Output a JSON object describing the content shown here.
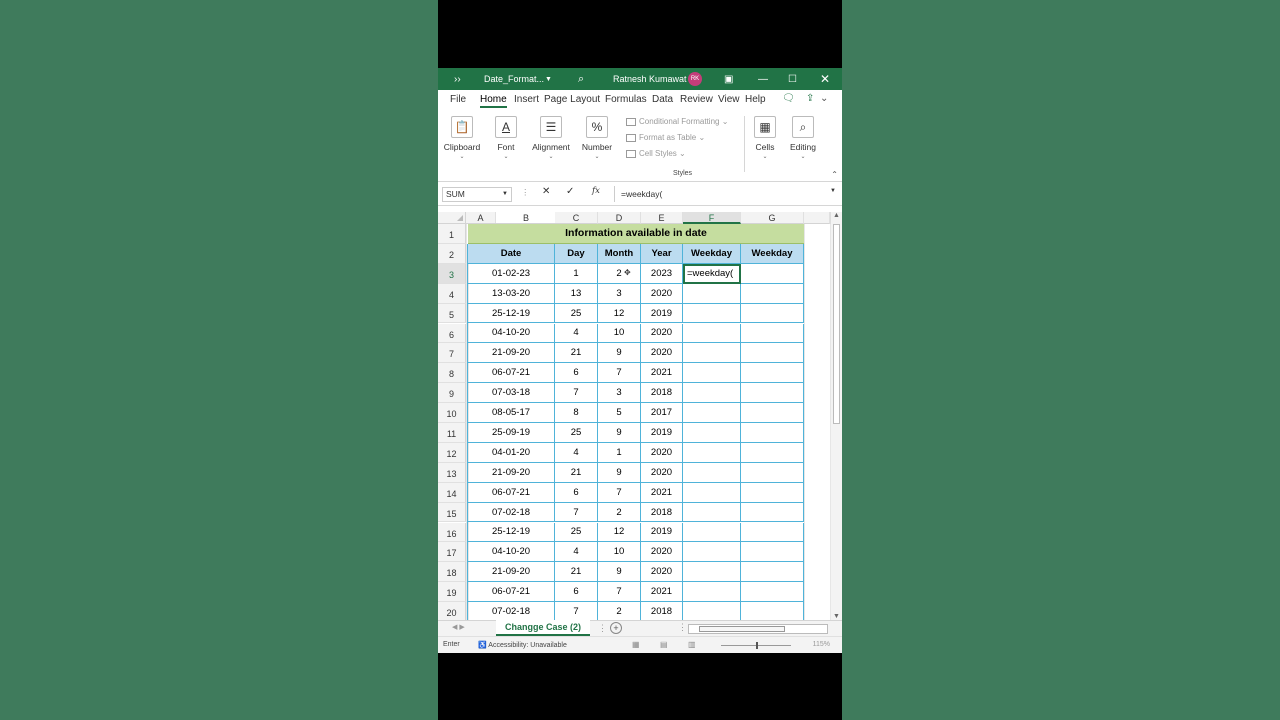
{
  "window": {
    "more": "››",
    "filename": "Date_Format...",
    "user": "Ratnesh Kumawat",
    "avatar_initials": "RK"
  },
  "menu_tabs": [
    "File",
    "Home",
    "Insert",
    "Page Layout",
    "Formulas",
    "Data",
    "Review",
    "View",
    "Help"
  ],
  "ribbon": {
    "clipboard": "Clipboard",
    "font": "Font",
    "alignment": "Alignment",
    "number": "Number",
    "conditional_formatting": "Conditional Formatting",
    "format_as_table": "Format as Table",
    "cell_styles": "Cell Styles",
    "styles": "Styles",
    "cells": "Cells",
    "editing": "Editing"
  },
  "formula_bar": {
    "name_box": "SUM",
    "formula": "=weekday("
  },
  "columns": [
    "A",
    "B",
    "C",
    "D",
    "E",
    "F",
    "G"
  ],
  "rows": [
    "1",
    "2",
    "3",
    "4",
    "5",
    "6",
    "7",
    "8",
    "9",
    "10",
    "11",
    "12",
    "13",
    "14",
    "15",
    "16",
    "17",
    "18",
    "19",
    "20"
  ],
  "table": {
    "title": "Information available in date",
    "headers": [
      "Date",
      "Day",
      "Month",
      "Year",
      "Weekday",
      "Weekday"
    ],
    "data": [
      [
        "01-02-23",
        "1",
        "2",
        "2023"
      ],
      [
        "13-03-20",
        "13",
        "3",
        "2020"
      ],
      [
        "25-12-19",
        "25",
        "12",
        "2019"
      ],
      [
        "04-10-20",
        "4",
        "10",
        "2020"
      ],
      [
        "21-09-20",
        "21",
        "9",
        "2020"
      ],
      [
        "06-07-21",
        "6",
        "7",
        "2021"
      ],
      [
        "07-03-18",
        "7",
        "3",
        "2018"
      ],
      [
        "08-05-17",
        "8",
        "5",
        "2017"
      ],
      [
        "25-09-19",
        "25",
        "9",
        "2019"
      ],
      [
        "04-01-20",
        "4",
        "1",
        "2020"
      ],
      [
        "21-09-20",
        "21",
        "9",
        "2020"
      ],
      [
        "06-07-21",
        "6",
        "7",
        "2021"
      ],
      [
        "07-02-18",
        "7",
        "2",
        "2018"
      ],
      [
        "25-12-19",
        "25",
        "12",
        "2019"
      ],
      [
        "04-10-20",
        "4",
        "10",
        "2020"
      ],
      [
        "21-09-20",
        "21",
        "9",
        "2020"
      ],
      [
        "06-07-21",
        "6",
        "7",
        "2021"
      ],
      [
        "07-02-18",
        "7",
        "2",
        "2018"
      ]
    ],
    "active_cell_text": "=weekday("
  },
  "sheet": {
    "tab_name": "Changge  Case (2)"
  },
  "status": {
    "mode": "Enter",
    "accessibility": "Accessibility: Unavailable",
    "zoom": "115%"
  },
  "colors": {
    "excel_green": "#217346",
    "title_fill": "#c5dd9f",
    "header_fill": "#bcdcf0",
    "border_blue": "#4fb3d9",
    "background": "#3f7b5c"
  }
}
